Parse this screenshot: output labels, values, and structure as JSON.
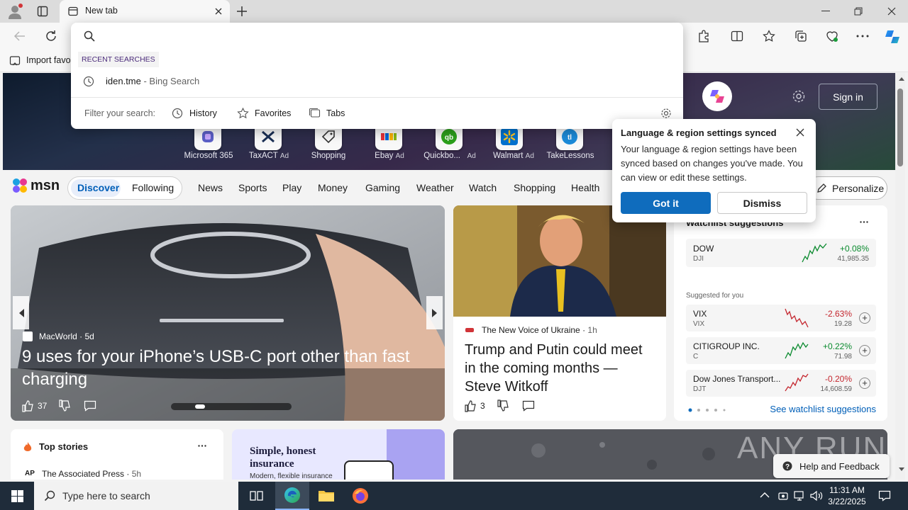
{
  "browser": {
    "tab_title": "New tab",
    "favorites_bar_label": "Import favo"
  },
  "omnibox": {
    "recent_header": "RECENT SEARCHES",
    "recent_query": "iden.tme",
    "recent_suffix": " - Bing Search",
    "filter_label": "Filter your search:",
    "filters": [
      "History",
      "Favorites",
      "Tabs"
    ]
  },
  "hero": {
    "sign_in": "Sign in",
    "tiles": [
      {
        "label": "Microsoft 365",
        "ad": ""
      },
      {
        "label": "TaxACT",
        "ad": "Ad"
      },
      {
        "label": "Shopping",
        "ad": ""
      },
      {
        "label": "Ebay",
        "ad": "Ad"
      },
      {
        "label": "Quickbo...",
        "ad": "Ad"
      },
      {
        "label": "Walmart",
        "ad": "Ad"
      },
      {
        "label": "TakeLessons",
        "ad": ""
      }
    ]
  },
  "msn": {
    "logo": "msn",
    "tabs": [
      "Discover",
      "Following"
    ],
    "categories": [
      "News",
      "Sports",
      "Play",
      "Money",
      "Gaming",
      "Weather",
      "Watch",
      "Shopping",
      "Health"
    ],
    "personalize": "Personalize"
  },
  "lang_popup": {
    "title": "Language & region settings synced",
    "body": "Your language & region settings have been synced based on changes you've made. You can view or edit these settings.",
    "got_it": "Got it",
    "dismiss": "Dismiss"
  },
  "main_story": {
    "source": "MacWorld",
    "age": "5d",
    "headline": "9 uses for your iPhone’s USB-C port other than fast charging",
    "likes": "37"
  },
  "second_story": {
    "source": "The New Voice of Ukraine",
    "age": "1h",
    "headline": "Trump and Putin could meet in the coming months — Steve Witkoff",
    "likes": "3"
  },
  "watchlist": {
    "title": "Watchlist suggestions",
    "suggested_label": "Suggested for you",
    "see_more": "See watchlist suggestions",
    "top": {
      "name": "DOW",
      "symbol": "DJI",
      "change": "+0.08%",
      "price": "41,985.35",
      "up": true
    },
    "items": [
      {
        "name": "VIX",
        "symbol": "VIX",
        "change": "-2.63%",
        "price": "19.28",
        "up": false
      },
      {
        "name": "CITIGROUP INC.",
        "symbol": "C",
        "change": "+0.22%",
        "price": "71.98",
        "up": true
      },
      {
        "name": "Dow Jones Transport...",
        "symbol": "DJT",
        "change": "-0.20%",
        "price": "14,608.59",
        "up": false
      }
    ]
  },
  "top_stories": {
    "title": "Top stories",
    "source": "The Associated Press",
    "age": "5h"
  },
  "ad_card": {
    "headline": "Simple, honest insurance",
    "sub": "Modern, flexible insurance"
  },
  "watermark": "ANY RUN",
  "help_feedback": "Help and Feedback",
  "taskbar": {
    "search_placeholder": "Type here to search",
    "time": "11:31 AM",
    "date": "3/22/2025"
  },
  "colors": {
    "accent": "#005fb8",
    "got_it_bg": "#0f6cbd",
    "up": "#0a8a2e",
    "down": "#c4262e"
  }
}
